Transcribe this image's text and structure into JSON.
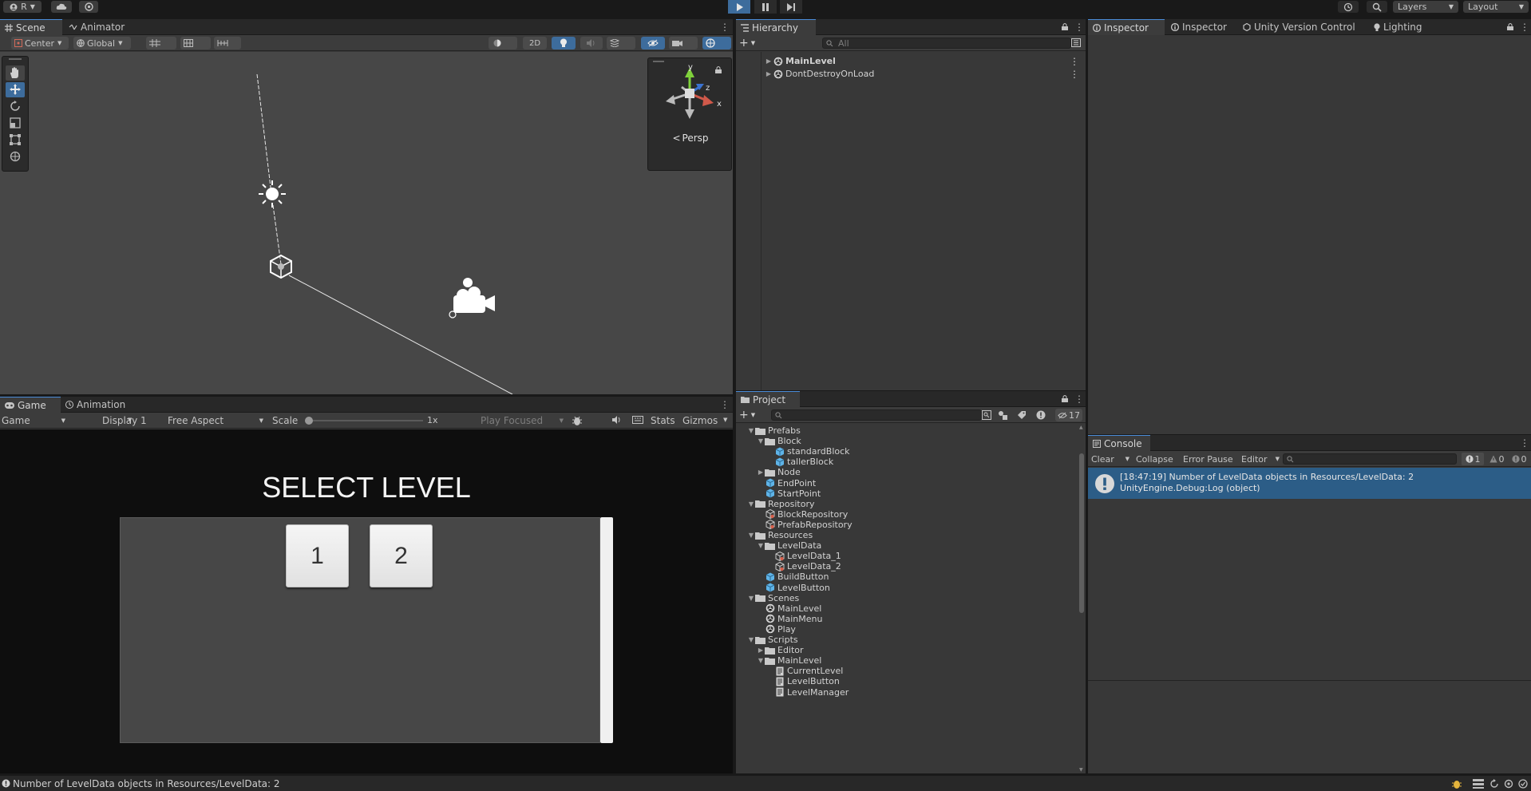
{
  "topbar": {
    "account_label": "R",
    "layers_label": "Layers",
    "layout_label": "Layout"
  },
  "scene": {
    "tabs": [
      {
        "label": "Scene",
        "icon": "scene-icon"
      },
      {
        "label": "Animator",
        "icon": "animator-icon"
      }
    ],
    "pivot_label": "Center",
    "space_label": "Global",
    "mode_2d_label": "2D",
    "gizmo_axes": {
      "y": "y",
      "z": "z",
      "x": "x"
    },
    "projection_label": "Persp"
  },
  "game": {
    "tabs": [
      {
        "label": "Game",
        "icon": "game-icon"
      },
      {
        "label": "Animation",
        "icon": "animation-icon"
      }
    ],
    "view_select": "Game",
    "display_select": "Display 1",
    "aspect_select": "Free Aspect",
    "scale_label": "Scale",
    "scale_value": "1x",
    "scale_fraction": 0.0,
    "play_mode_select": "Play Focused",
    "stats_label": "Stats",
    "gizmos_label": "Gizmos",
    "canvas": {
      "title": "SELECT LEVEL",
      "levels": [
        "1",
        "2"
      ]
    }
  },
  "hierarchy": {
    "tab_label": "Hierarchy",
    "search_placeholder": "All",
    "items": [
      {
        "label": "MainLevel",
        "bold": true
      },
      {
        "label": "DontDestroyOnLoad",
        "bold": false
      }
    ]
  },
  "inspector": {
    "tabs": [
      {
        "label": "Inspector",
        "icon": "inspector-icon"
      },
      {
        "label": "Inspector",
        "icon": "inspector-icon"
      },
      {
        "label": "Unity Version Control",
        "icon": "version-control-icon"
      },
      {
        "label": "Lighting",
        "icon": "lighting-icon"
      }
    ]
  },
  "project": {
    "tab_label": "Project",
    "hidden_count": "17",
    "tree": [
      {
        "label": "Prefabs",
        "type": "folder",
        "depth": 0,
        "arrow": "open"
      },
      {
        "label": "Block",
        "type": "folder",
        "depth": 1,
        "arrow": "open"
      },
      {
        "label": "standardBlock",
        "type": "prefab",
        "depth": 2,
        "arrow": "none"
      },
      {
        "label": "tallerBlock",
        "type": "prefab",
        "depth": 2,
        "arrow": "none"
      },
      {
        "label": "Node",
        "type": "folder",
        "depth": 1,
        "arrow": "closed"
      },
      {
        "label": "EndPoint",
        "type": "prefab",
        "depth": 1,
        "arrow": "none"
      },
      {
        "label": "StartPoint",
        "type": "prefab",
        "depth": 1,
        "arrow": "none"
      },
      {
        "label": "Repository",
        "type": "folder",
        "depth": 0,
        "arrow": "open"
      },
      {
        "label": "BlockRepository",
        "type": "asset",
        "depth": 1,
        "arrow": "none"
      },
      {
        "label": "PrefabRepository",
        "type": "asset",
        "depth": 1,
        "arrow": "none"
      },
      {
        "label": "Resources",
        "type": "folder",
        "depth": 0,
        "arrow": "open"
      },
      {
        "label": "LevelData",
        "type": "folder",
        "depth": 1,
        "arrow": "open"
      },
      {
        "label": "LevelData_1",
        "type": "asset",
        "depth": 2,
        "arrow": "none"
      },
      {
        "label": "LevelData_2",
        "type": "asset",
        "depth": 2,
        "arrow": "none"
      },
      {
        "label": "BuildButton",
        "type": "prefab",
        "depth": 1,
        "arrow": "none"
      },
      {
        "label": "LevelButton",
        "type": "prefab",
        "depth": 1,
        "arrow": "none"
      },
      {
        "label": "Scenes",
        "type": "folder",
        "depth": 0,
        "arrow": "open"
      },
      {
        "label": "MainLevel",
        "type": "scene",
        "depth": 1,
        "arrow": "none"
      },
      {
        "label": "MainMenu",
        "type": "scene",
        "depth": 1,
        "arrow": "none"
      },
      {
        "label": "Play",
        "type": "scene",
        "depth": 1,
        "arrow": "none"
      },
      {
        "label": "Scripts",
        "type": "folder",
        "depth": 0,
        "arrow": "open"
      },
      {
        "label": "Editor",
        "type": "folder",
        "depth": 1,
        "arrow": "closed"
      },
      {
        "label": "MainLevel",
        "type": "folder",
        "depth": 1,
        "arrow": "open"
      },
      {
        "label": "CurrentLevel",
        "type": "script",
        "depth": 2,
        "arrow": "none"
      },
      {
        "label": "LevelButton",
        "type": "script",
        "depth": 2,
        "arrow": "none"
      },
      {
        "label": "LevelManager",
        "type": "script",
        "depth": 2,
        "arrow": "none"
      }
    ]
  },
  "console": {
    "tab_label": "Console",
    "clear_label": "Clear",
    "collapse_label": "Collapse",
    "error_pause_label": "Error Pause",
    "editor_label": "Editor",
    "log_count": "1",
    "warn_count": "0",
    "error_count": "0",
    "entries": [
      {
        "line1": "[18:47:19] Number of LevelData objects in Resources/LevelData: 2",
        "line2": "UnityEngine.Debug:Log (object)"
      }
    ]
  },
  "statusbar": {
    "message": "Number of LevelData objects in Resources/LevelData: 2"
  },
  "colors": {
    "accent": "#4a8cd8",
    "selection": "#2c5d87",
    "prefab": "#5fb4e8"
  }
}
